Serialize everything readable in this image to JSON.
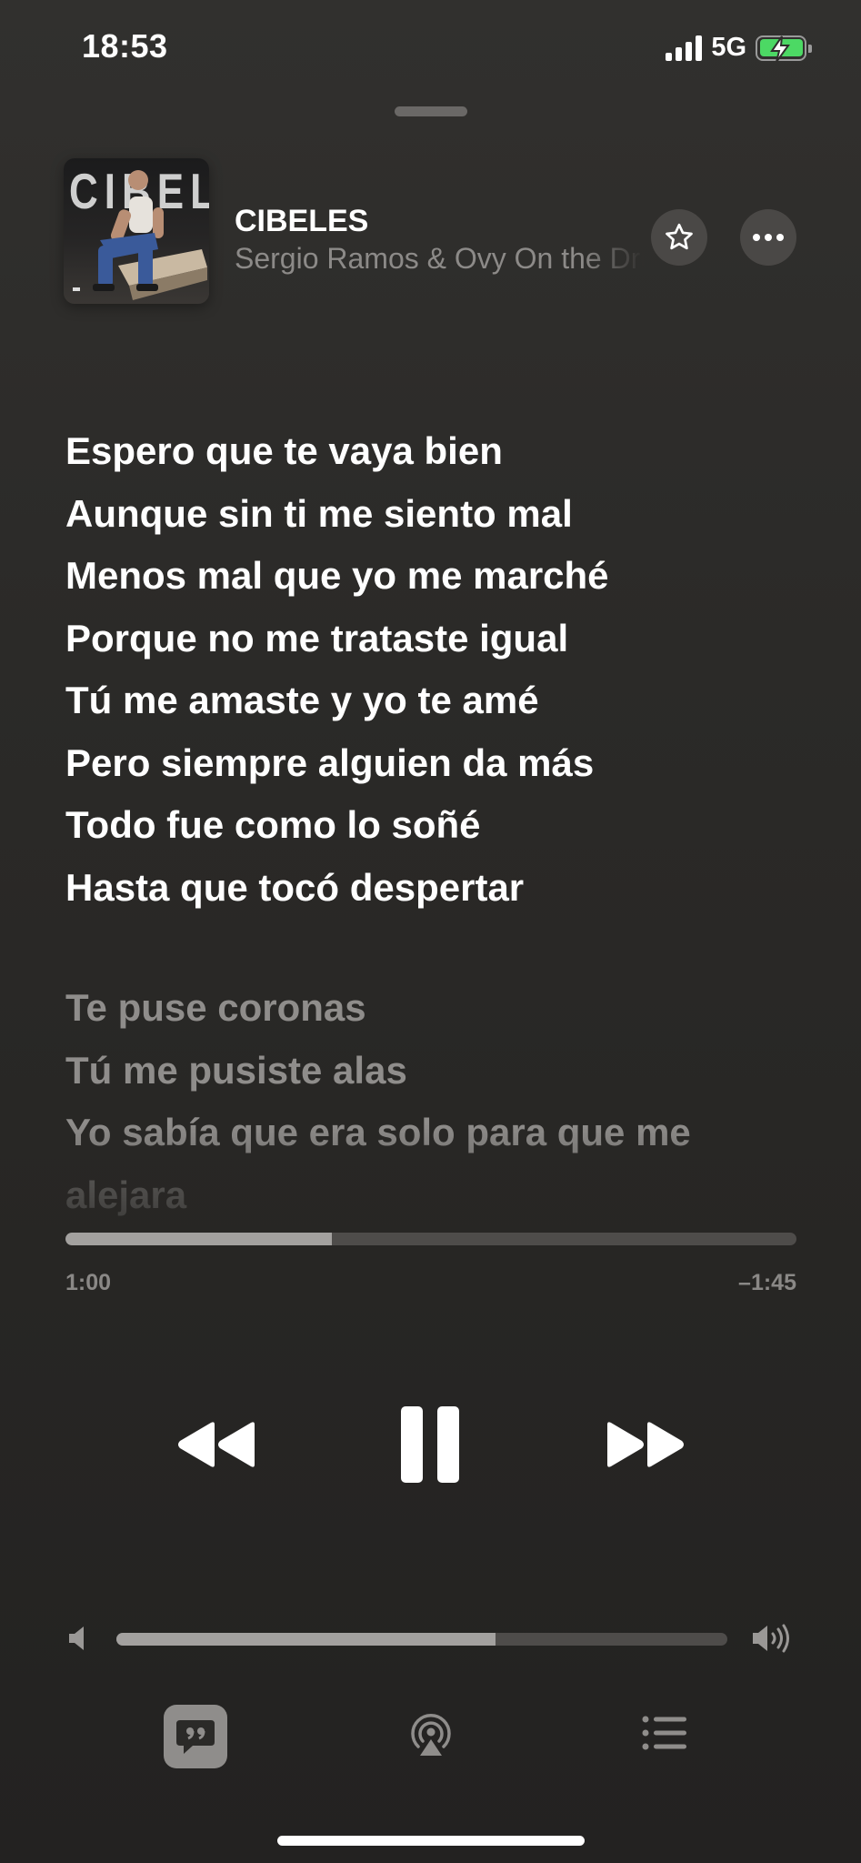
{
  "status_bar": {
    "time": "18:53",
    "network": "5G",
    "battery": 1.0,
    "battery_state": "charging"
  },
  "track": {
    "artwork_text": "CIBELES",
    "title": "CIBELES",
    "artist": "Sergio Ramos & Ovy On the Drums"
  },
  "lyrics": {
    "current_block": [
      "Espero que te vaya bien",
      "Aunque sin ti me siento mal",
      "Menos mal que yo me marché",
      "Porque no me trataste igual",
      "Tú me amaste y yo te amé",
      "Pero siempre alguien da más",
      "Todo fue como lo soñé",
      "Hasta que tocó despertar"
    ],
    "next_block": [
      "Te puse coronas",
      "Tú me pusiste alas",
      "Yo sabía que era solo para que me",
      "alejara"
    ]
  },
  "playback": {
    "elapsed": "1:00",
    "remaining": "–1:45",
    "progress_fraction": 0.364,
    "state": "playing",
    "volume_fraction": 0.62
  },
  "icons": {
    "favorite": "star-icon",
    "more": "ellipsis-icon",
    "rewind": "rewind-icon",
    "pause": "pause-icon",
    "forward": "fast-forward-icon",
    "volume_low": "speaker-low-icon",
    "volume_high": "speaker-high-icon",
    "lyrics": "lyrics-quote-icon",
    "airplay": "airplay-icon",
    "queue": "list-icon"
  },
  "colors": {
    "background": "#2b2a28",
    "lyric_active": "#ffffff",
    "lyric_inactive": "#8f8d8b",
    "track_fill": "#a3a19f",
    "track_bg": "#4e4c4a",
    "battery_fill": "#4cd964"
  }
}
